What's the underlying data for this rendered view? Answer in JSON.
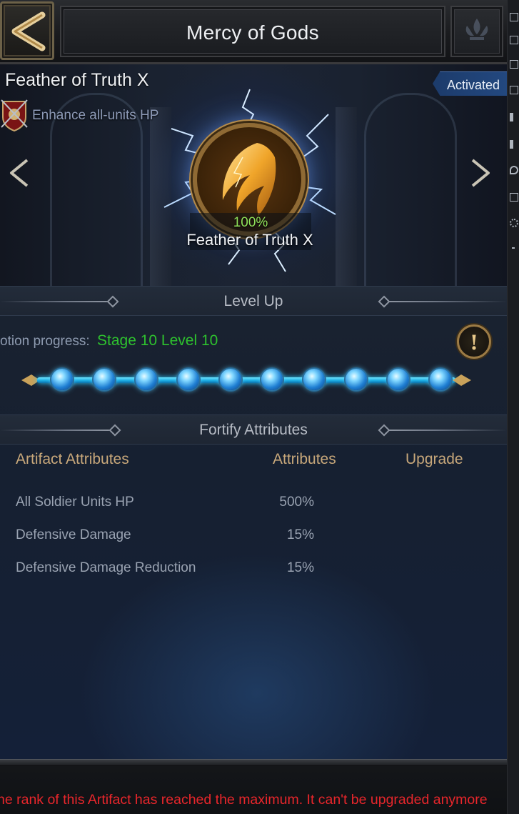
{
  "header": {
    "title": "Mercy of Gods"
  },
  "artifact": {
    "name": "Feather of Truth X",
    "status": "Activated",
    "effect": "Enhance all-units HP",
    "percent": "100%",
    "display_name": "Feather of Truth X"
  },
  "level_up": {
    "title": "Level Up",
    "progress_label": "otion progress:",
    "progress_value": "Stage 10 Level 10",
    "stages_completed": 10,
    "stages_total": 10
  },
  "fortify": {
    "title": "Fortify Attributes",
    "columns": [
      "Artifact Attributes",
      "Attributes",
      "Upgrade"
    ],
    "rows": [
      {
        "name": "All Soldier Units HP",
        "value": "500%"
      },
      {
        "name": "Defensive Damage",
        "value": "15%"
      },
      {
        "name": "Defensive Damage Reduction",
        "value": "15%"
      }
    ]
  },
  "footer": {
    "message": "he rank of this Artifact has reached the maximum. It can't be upgraded anymore"
  },
  "colors": {
    "accent_gold": "#c7a77a",
    "progress_green": "#2ec22e",
    "warning_red": "#e8262b",
    "activated_blue": "#23487f"
  }
}
